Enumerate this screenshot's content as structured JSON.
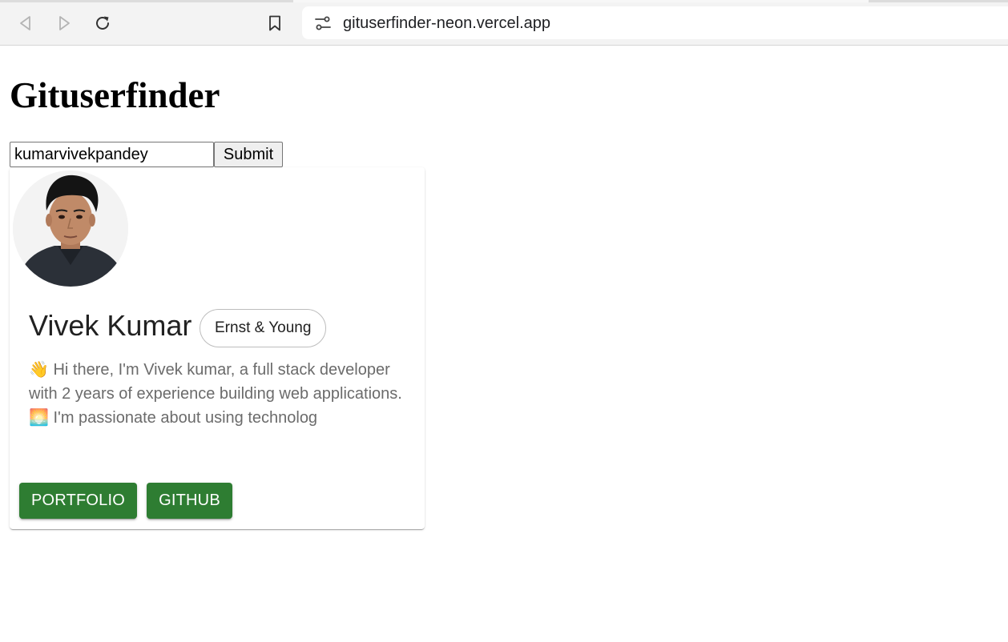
{
  "browser": {
    "url": "gituserfinder-neon.vercel.app"
  },
  "page": {
    "title": "Gituserfinder"
  },
  "search": {
    "value": "kumarvivekpandey",
    "submit_label": "Submit"
  },
  "profile": {
    "name": "Vivek Kumar",
    "company": "Ernst & Young",
    "bio": "👋 Hi there, I'm Vivek kumar, a full stack developer with 2 years of experience building web applications. 🌅 I'm passionate about using technolog",
    "portfolio_label": "PORTFOLIO",
    "github_label": "GITHUB"
  },
  "colors": {
    "button_green": "#2e7d32",
    "chrome_background": "#f3f3f3"
  }
}
